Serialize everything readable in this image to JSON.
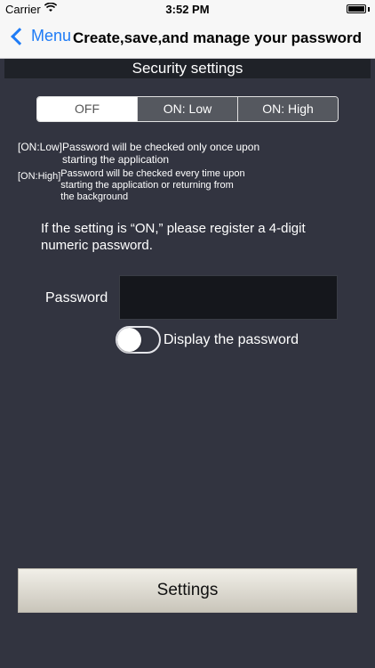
{
  "status_bar": {
    "carrier": "Carrier",
    "time": "3:52 PM",
    "wifi_icon": "wifi-icon",
    "battery_icon": "battery-icon"
  },
  "nav": {
    "back_label": "Menu",
    "title": "Create,save,and manage your password"
  },
  "section_title": "Security settings",
  "segments": [
    "OFF",
    "ON: Low",
    "ON: High"
  ],
  "selected_segment": "OFF",
  "descriptions": {
    "low_tag": "[ON:Low]",
    "low_line1": "Password will be checked only once upon",
    "low_line2": "starting the application",
    "high_tag": "[ON:High]",
    "high_line1": "Password will be checked every time upon",
    "high_line2": "starting the application or returning from",
    "high_line3": "the background"
  },
  "info_text": "If the setting is “ON,” please register a 4-digit numeric password.",
  "password": {
    "label": "Password",
    "value": "",
    "placeholder": ""
  },
  "display_toggle": {
    "label": "Display the password",
    "state": "off"
  },
  "settings_button": "Settings",
  "colors": {
    "background": "#323440",
    "accent": "#1f7cf6",
    "section_header": "#1f2228"
  }
}
